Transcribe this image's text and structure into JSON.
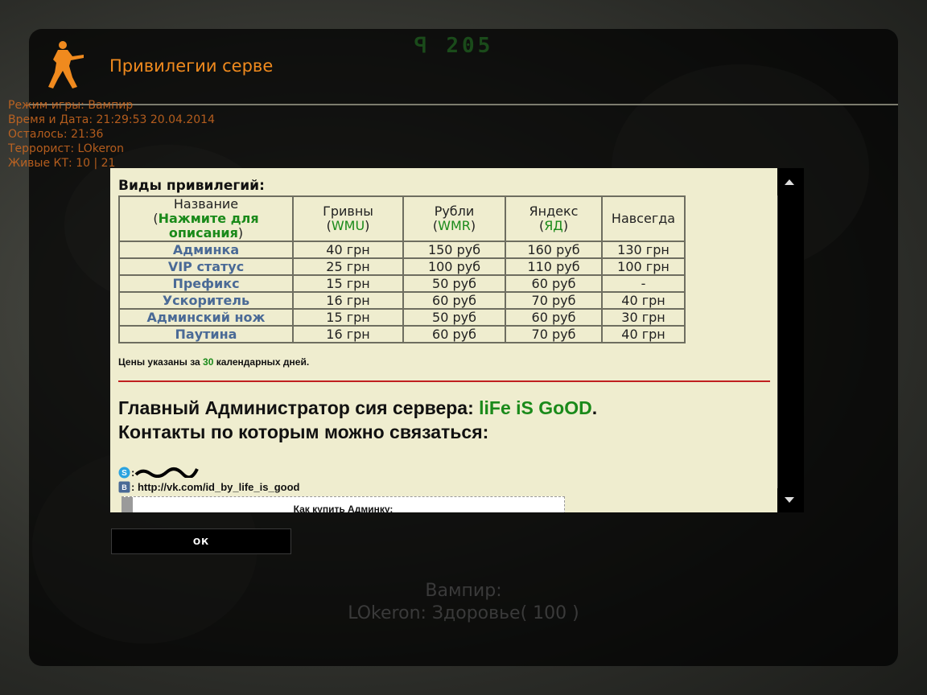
{
  "window": {
    "title": "Привилегии серве",
    "ok_label": "ОК"
  },
  "hud": {
    "top_counter": "ꟼ 205",
    "mode": "Режим игры: Вампир",
    "datetime": "Время и Дата: 21:29:53 20.04.2014",
    "remaining": "Осталось: 21:36",
    "terrorist": "Террорист: LOkeron",
    "alive_ct": "Живые КТ: 10 | 21"
  },
  "content": {
    "heading": "Виды привилегий:",
    "table": {
      "header_name_line1": "Название",
      "header_name_open": "(",
      "header_name_link": "Нажмите для описания",
      "header_name_close": ")",
      "columns": [
        {
          "label": "Гривны",
          "code": "WMU"
        },
        {
          "label": "Рубли",
          "code": "WMR"
        },
        {
          "label": "Яндекс",
          "code": "ЯД"
        }
      ],
      "forever_label": "Навсегда",
      "rows": [
        {
          "name": "Админка",
          "uah": "40 грн",
          "rub": "150 руб",
          "yd": "160 руб",
          "forever": "130 грн"
        },
        {
          "name": "VIP статус",
          "uah": "25 грн",
          "rub": "100 руб",
          "yd": "110 руб",
          "forever": "100 грн"
        },
        {
          "name": "Префикс",
          "uah": "15 грн",
          "rub": "50 руб",
          "yd": "60 руб",
          "forever": "-"
        },
        {
          "name": "Ускоритель",
          "uah": "16 грн",
          "rub": "60 руб",
          "yd": "70 руб",
          "forever": "40 грн"
        },
        {
          "name": "Админский нож",
          "uah": "15 грн",
          "rub": "50 руб",
          "yd": "60 руб",
          "forever": "30 грн"
        },
        {
          "name": "Паутина",
          "uah": "16 грн",
          "rub": "60 руб",
          "yd": "70 руб",
          "forever": "40 грн"
        }
      ]
    },
    "prices_note_pre": "Цены указаны за ",
    "prices_note_days": "30",
    "prices_note_post": " календарных дней.",
    "admin_pre": "Главный Администратор сия сервера: ",
    "admin_name": "liFe iS GoOD",
    "admin_post": ".",
    "contacts_heading": "Контакты по которым можно связаться:",
    "skype_sep": ":",
    "vk_text": ": http://vk.com/id_by_life_is_good",
    "howto_title": "Как купить Админку:"
  },
  "status": {
    "mode": "Вампир:",
    "health": "LOkeron: Здоровье( 100 )"
  },
  "colors": {
    "title": "#f08a1e",
    "accent_green": "#1a8a1a",
    "link_blue": "#4a6a96",
    "divider_red": "#c02020",
    "panel_bg": "#efedcf"
  }
}
